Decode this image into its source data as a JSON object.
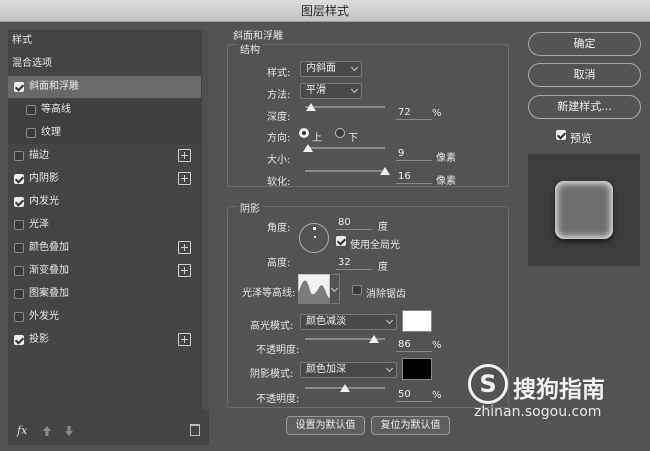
{
  "window": {
    "title": "图层样式"
  },
  "left_panel": {
    "items": [
      {
        "label": "样式",
        "checkbox": null,
        "plus": false,
        "selected": false,
        "indent": 0
      },
      {
        "label": "混合选项",
        "checkbox": null,
        "plus": false,
        "selected": false,
        "indent": 0
      },
      {
        "label": "斜面和浮雕",
        "checkbox": true,
        "plus": false,
        "selected": true,
        "indent": 0
      },
      {
        "label": "等高线",
        "checkbox": false,
        "plus": false,
        "selected": false,
        "indent": 1
      },
      {
        "label": "纹理",
        "checkbox": false,
        "plus": false,
        "selected": false,
        "indent": 1
      },
      {
        "label": "描边",
        "checkbox": false,
        "plus": true,
        "selected": false,
        "indent": 0
      },
      {
        "label": "内阴影",
        "checkbox": true,
        "plus": true,
        "selected": false,
        "indent": 0
      },
      {
        "label": "内发光",
        "checkbox": true,
        "plus": false,
        "selected": false,
        "indent": 0
      },
      {
        "label": "光泽",
        "checkbox": false,
        "plus": false,
        "selected": false,
        "indent": 0
      },
      {
        "label": "颜色叠加",
        "checkbox": false,
        "plus": true,
        "selected": false,
        "indent": 0
      },
      {
        "label": "渐变叠加",
        "checkbox": false,
        "plus": true,
        "selected": false,
        "indent": 0
      },
      {
        "label": "图案叠加",
        "checkbox": false,
        "plus": false,
        "selected": false,
        "indent": 0
      },
      {
        "label": "外发光",
        "checkbox": false,
        "plus": false,
        "selected": false,
        "indent": 0
      },
      {
        "label": "投影",
        "checkbox": true,
        "plus": true,
        "selected": false,
        "indent": 0
      }
    ],
    "footer": {
      "fx_label": "fx"
    }
  },
  "bevel": {
    "section_title": "斜面和浮雕",
    "structure_title": "结构",
    "style_label": "样式:",
    "style_value": "内斜面",
    "method_label": "方法:",
    "method_value": "平滑",
    "depth_label": "深度:",
    "depth_value": "72",
    "depth_unit": "%",
    "depth_fraction": 0.072,
    "direction_label": "方向:",
    "direction_up": "上",
    "direction_down": "下",
    "direction_selected": "上",
    "size_label": "大小:",
    "size_value": "9",
    "size_unit": "像素",
    "size_fraction": 0.036,
    "soften_label": "软化:",
    "soften_value": "16",
    "soften_unit": "像素",
    "soften_fraction": 1.0,
    "shading_title": "阴影",
    "angle_label": "角度:",
    "angle_value": "80",
    "angle_unit": "度",
    "global_light_label": "使用全局光",
    "global_light_checked": true,
    "altitude_label": "高度:",
    "altitude_value": "32",
    "altitude_unit": "度",
    "gloss_contour_label": "光泽等高线:",
    "anti_alias_label": "消除锯齿",
    "anti_alias_checked": false,
    "highlight_mode_label": "高光模式:",
    "highlight_mode_value": "颜色减淡",
    "highlight_color": "#ffffff",
    "highlight_opacity_label": "不透明度:",
    "highlight_opacity_value": "86",
    "highlight_opacity_unit": "%",
    "highlight_opacity_fraction": 0.86,
    "shadow_mode_label": "阴影模式:",
    "shadow_mode_value": "颜色加深",
    "shadow_color": "#000000",
    "shadow_opacity_label": "不透明度:",
    "shadow_opacity_value": "50",
    "shadow_opacity_unit": "%",
    "shadow_opacity_fraction": 0.5,
    "make_default_label": "设置为默认值",
    "reset_default_label": "复位为默认值"
  },
  "right_panel": {
    "ok_label": "确定",
    "cancel_label": "取消",
    "new_style_label": "新建样式...",
    "preview_label": "预览",
    "preview_checked": true
  },
  "watermark": {
    "brand": "搜狗指南",
    "url": "zhinan.sogou.com",
    "logo_letter": "S"
  }
}
